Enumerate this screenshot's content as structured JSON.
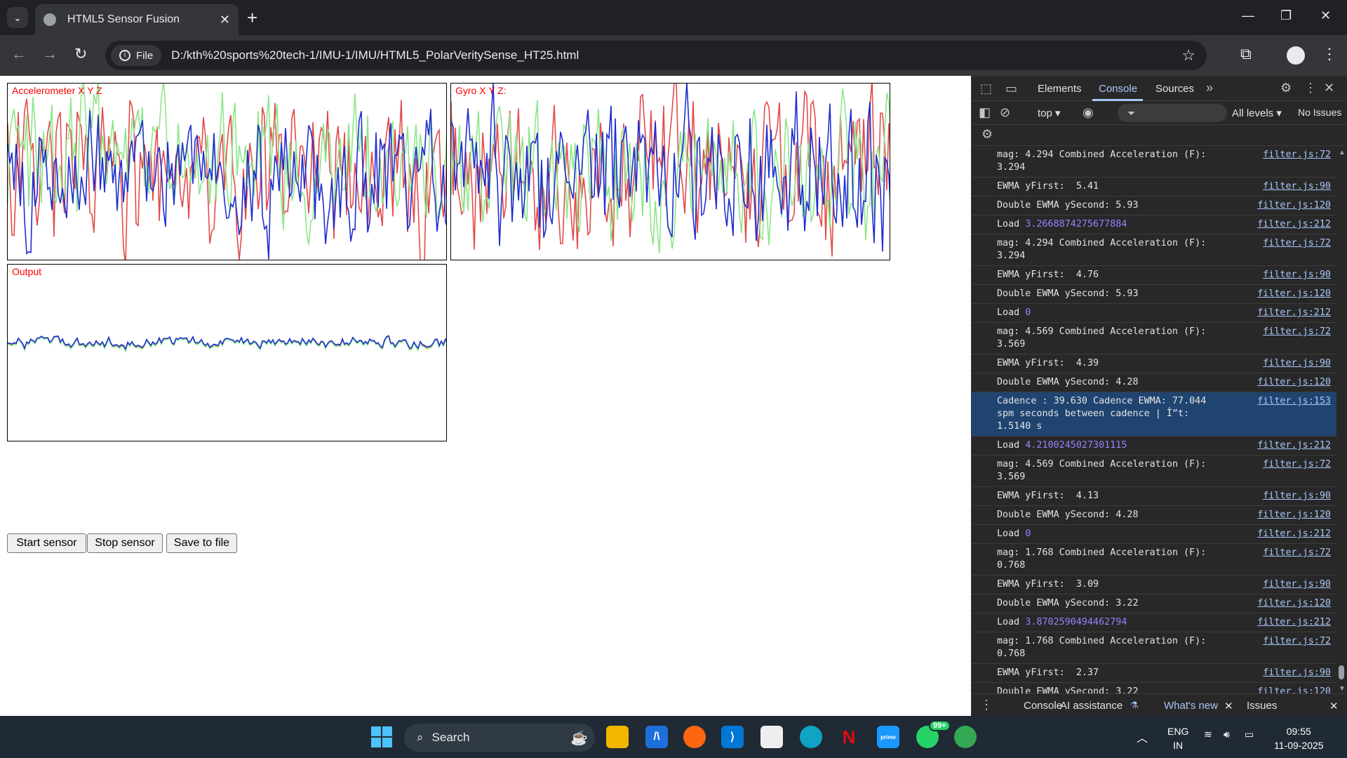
{
  "browser": {
    "tab_title": "HTML5 Sensor Fusion",
    "tab_close": "✕",
    "new_tab": "+",
    "site_chip": "File",
    "url": "D:/kth%20sports%20tech-1/IMU-1/IMU/HTML5_PolarVeritySense_HT25.html"
  },
  "page": {
    "accel_label": "Accelerometer X Y Z",
    "gyro_label": "Gyro X Y Z:",
    "output_label": "Output",
    "buttons": {
      "start": "Start sensor",
      "stop": "Stop sensor",
      "save": "Save to file"
    },
    "colors": {
      "x": "#e34b4b",
      "y": "#8ee68a",
      "z": "#1f2fd0"
    }
  },
  "devtools": {
    "tabs": [
      "Elements",
      "Console",
      "Sources"
    ],
    "active_tab": "Console",
    "context": "top ▾",
    "levels": "All levels ▾",
    "issues": "No Issues",
    "bottom_tabs": [
      "Console",
      "AI assistance",
      "What's new",
      "Issues"
    ],
    "logs": [
      {
        "msg": "mag: 4.294 Combined Acceleration (F):\n3.294",
        "src": "filter.js:72"
      },
      {
        "msg": "EWMA yFirst:  5.41",
        "src": "filter.js:90"
      },
      {
        "msg": "Double EWMA ySecond: 5.93",
        "src": "filter.js:120"
      },
      {
        "msg": "Load ",
        "num": "3.2668874275677884",
        "src": "filter.js:212"
      },
      {
        "msg": "mag: 4.294 Combined Acceleration (F):\n3.294",
        "src": "filter.js:72"
      },
      {
        "msg": "EWMA yFirst:  4.76",
        "src": "filter.js:90"
      },
      {
        "msg": "Double EWMA ySecond: 5.93",
        "src": "filter.js:120"
      },
      {
        "msg": "Load ",
        "num": "0",
        "src": "filter.js:212"
      },
      {
        "msg": "mag: 4.569 Combined Acceleration (F):\n3.569",
        "src": "filter.js:72"
      },
      {
        "msg": "EWMA yFirst:  4.39",
        "src": "filter.js:90"
      },
      {
        "msg": "Double EWMA ySecond: 4.28",
        "src": "filter.js:120"
      },
      {
        "msg": "Cadence : 39.630 Cadence EWMA: 77.044\nspm seconds between cadence | Î”t: 1.5140 s",
        "src": "filter.js:153",
        "sel": true
      },
      {
        "msg": "Load ",
        "num": "4.2100245027301115",
        "src": "filter.js:212"
      },
      {
        "msg": "mag: 4.569 Combined Acceleration (F):\n3.569",
        "src": "filter.js:72"
      },
      {
        "msg": "EWMA yFirst:  4.13",
        "src": "filter.js:90"
      },
      {
        "msg": "Double EWMA ySecond: 4.28",
        "src": "filter.js:120"
      },
      {
        "msg": "Load ",
        "num": "0",
        "src": "filter.js:212"
      },
      {
        "msg": "mag: 1.768 Combined Acceleration (F):\n0.768",
        "src": "filter.js:72"
      },
      {
        "msg": "EWMA yFirst:  3.09",
        "src": "filter.js:90"
      },
      {
        "msg": "Double EWMA ySecond: 3.22",
        "src": "filter.js:120"
      },
      {
        "msg": "Load ",
        "num": "3.8702590494462794",
        "src": "filter.js:212"
      },
      {
        "msg": "mag: 1.768 Combined Acceleration (F):\n0.768",
        "src": "filter.js:72"
      },
      {
        "msg": "EWMA yFirst:  2.37",
        "src": "filter.js:90"
      },
      {
        "msg": "Double EWMA ySecond: 3.22",
        "src": "filter.js:120"
      }
    ]
  },
  "taskbar": {
    "search": "Search",
    "whatsapp_badge": "99+",
    "lang": "ENG",
    "region": "IN",
    "time": "09:55",
    "date": "11-09-2025"
  }
}
